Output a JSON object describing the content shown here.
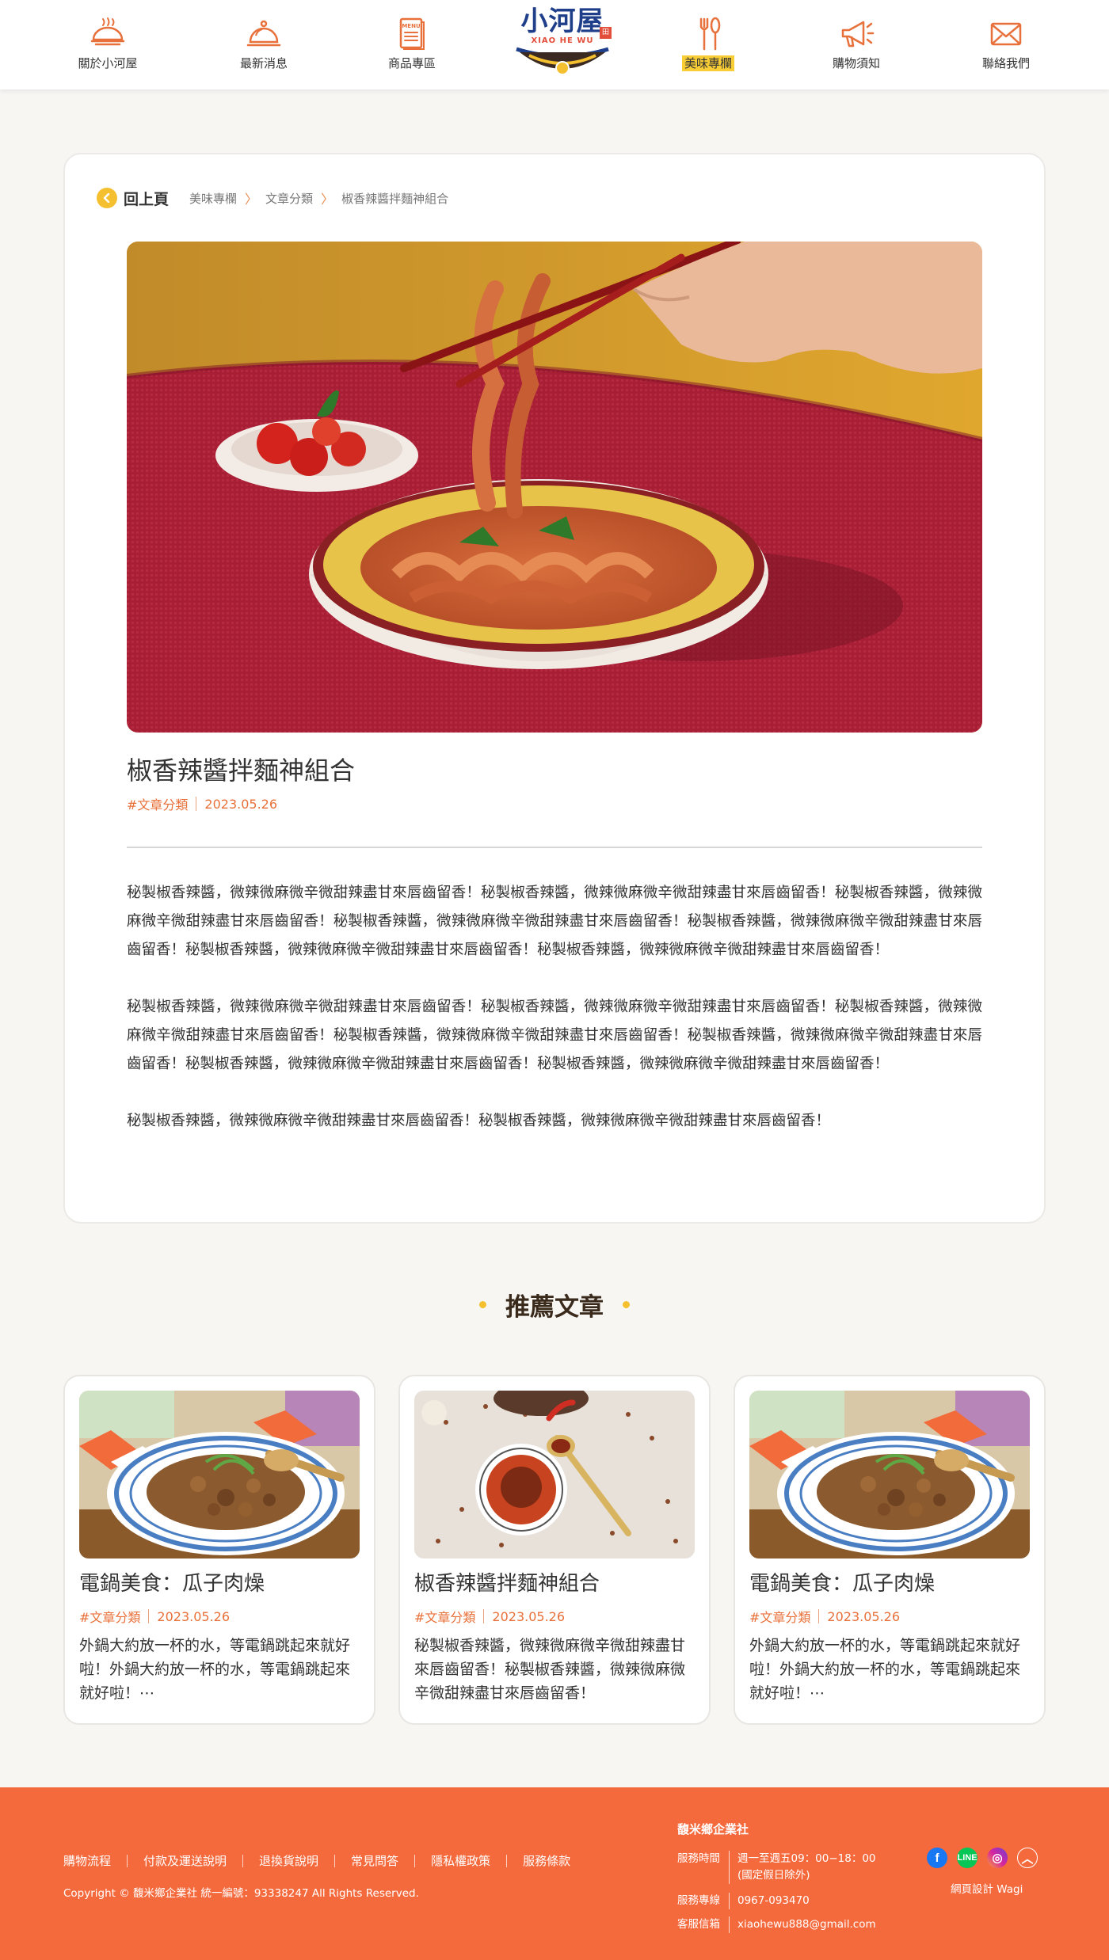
{
  "nav": {
    "items": [
      {
        "label": "關於小河屋",
        "icon": "steaming-bowl-icon"
      },
      {
        "label": "最新消息",
        "icon": "cloche-icon"
      },
      {
        "label": "商品專區",
        "icon": "menu-book-icon"
      },
      {
        "label": "美味專欄",
        "icon": "fork-spoon-icon"
      },
      {
        "label": "購物須知",
        "icon": "megaphone-icon"
      },
      {
        "label": "聯絡我們",
        "icon": "envelope-icon"
      }
    ],
    "active": "美味專欄",
    "logo": {
      "title": "小河屋",
      "tag": "田",
      "subtitle": "XIAO HE WU"
    }
  },
  "colors": {
    "accent": "#f46a3d",
    "highlight": "#f9cd35",
    "brand_blue": "#1f3f8a",
    "tag_orange": "#e8703a"
  },
  "breadcrumb": {
    "back_label": "回上頁",
    "items": [
      "美味專欄",
      "文章分類",
      "椒香辣醬拌麵神組合"
    ]
  },
  "article": {
    "title": "椒香辣醬拌麵神組合",
    "category": "#文章分類",
    "date": "2023.05.26",
    "paragraphs": [
      "秘製椒香辣醬，微辣微麻微辛微甜辣盡甘來唇齒留香！秘製椒香辣醬，微辣微麻微辛微甜辣盡甘來唇齒留香！秘製椒香辣醬，微辣微麻微辛微甜辣盡甘來唇齒留香！秘製椒香辣醬，微辣微麻微辛微甜辣盡甘來唇齒留香！秘製椒香辣醬，微辣微麻微辛微甜辣盡甘來唇齒留香！秘製椒香辣醬，微辣微麻微辛微甜辣盡甘來唇齒留香！秘製椒香辣醬，微辣微麻微辛微甜辣盡甘來唇齒留香！",
      "秘製椒香辣醬，微辣微麻微辛微甜辣盡甘來唇齒留香！秘製椒香辣醬，微辣微麻微辛微甜辣盡甘來唇齒留香！秘製椒香辣醬，微辣微麻微辛微甜辣盡甘來唇齒留香！秘製椒香辣醬，微辣微麻微辛微甜辣盡甘來唇齒留香！秘製椒香辣醬，微辣微麻微辛微甜辣盡甘來唇齒留香！秘製椒香辣醬，微辣微麻微辛微甜辣盡甘來唇齒留香！秘製椒香辣醬，微辣微麻微辛微甜辣盡甘來唇齒留香！",
      "秘製椒香辣醬，微辣微麻微辛微甜辣盡甘來唇齒留香！秘製椒香辣醬，微辣微麻微辛微甜辣盡甘來唇齒留香！"
    ]
  },
  "recommended": {
    "heading": "推薦文章",
    "cards": [
      {
        "title": "電鍋美食：瓜子肉燥",
        "category": "#文章分類",
        "date": "2023.05.26",
        "excerpt": "外鍋大約放一杯的水，等電鍋跳起來就好啦！外鍋大約放一杯的水，等電鍋跳起來就好啦！⋯",
        "image": "braised-pork-bowl"
      },
      {
        "title": "椒香辣醬拌麵神組合",
        "category": "#文章分類",
        "date": "2023.05.26",
        "excerpt": "秘製椒香辣醬，微辣微麻微辛微甜辣盡甘來唇齒留香！秘製椒香辣醬，微辣微麻微辛微甜辣盡甘來唇齒留香！",
        "image": "chili-sauce-bowl"
      },
      {
        "title": "電鍋美食：瓜子肉燥",
        "category": "#文章分類",
        "date": "2023.05.26",
        "excerpt": "外鍋大約放一杯的水，等電鍋跳起來就好啦！外鍋大約放一杯的水，等電鍋跳起來就好啦！⋯",
        "image": "braised-pork-bowl"
      }
    ]
  },
  "footer": {
    "links": [
      "購物流程",
      "付款及運送說明",
      "退換貨說明",
      "常見問答",
      "隱私權政策",
      "服務條款"
    ],
    "copyright": "Copyright © 馥米鄉企業社 統一編號：93338247 All Rights Reserved.",
    "company": "馥米鄉企業社",
    "hours_label": "服務時間",
    "hours_value": "週一至週五09：00−18：00",
    "hours_note": "(國定假日除外)",
    "phone_label": "服務專線",
    "phone_value": "0967-093470",
    "email_label": "客服信箱",
    "email_value": "xiaohewu888@gmail.com",
    "social": [
      {
        "icon": "facebook-icon",
        "glyph": "f",
        "color": "#1877f2"
      },
      {
        "icon": "line-icon",
        "glyph": "L",
        "color": "#06c755"
      },
      {
        "icon": "instagram-icon",
        "glyph": "◎",
        "color": "#c13584"
      },
      {
        "icon": "back-to-top-icon",
        "glyph": "︿",
        "color": "transparent"
      }
    ],
    "credit": "網頁設計 Wagi"
  }
}
